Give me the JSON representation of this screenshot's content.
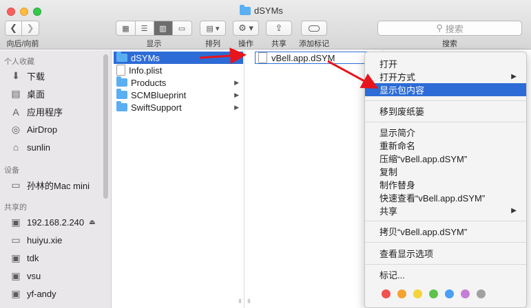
{
  "window": {
    "title": "dSYMs"
  },
  "toolbar": {
    "nav_label": "向后/向前",
    "view_label": "显示",
    "arrange_label": "排列",
    "action_label": "操作",
    "share_label": "共享",
    "tags_label": "添加标记",
    "search_placeholder": "搜索",
    "search_label": "搜索"
  },
  "sidebar": {
    "sections": [
      {
        "title": "个人收藏",
        "items": [
          {
            "label": "下载",
            "icon": "download-icon"
          },
          {
            "label": "桌面",
            "icon": "desktop-icon"
          },
          {
            "label": "应用程序",
            "icon": "applications-icon"
          },
          {
            "label": "AirDrop",
            "icon": "airdrop-icon"
          },
          {
            "label": "sunlin",
            "icon": "home-icon"
          }
        ]
      },
      {
        "title": "设备",
        "items": [
          {
            "label": "孙林的Mac mini",
            "icon": "harddrive-icon"
          }
        ]
      },
      {
        "title": "共享的",
        "items": [
          {
            "label": "192.168.2.240",
            "icon": "server-icon"
          },
          {
            "label": "huiyu.xie",
            "icon": "display-icon"
          },
          {
            "label": "tdk",
            "icon": "display-icon"
          },
          {
            "label": "vsu",
            "icon": "display-icon"
          },
          {
            "label": "yf-andy",
            "icon": "display-icon"
          }
        ]
      }
    ]
  },
  "column1": {
    "items": [
      {
        "name": "dSYMs",
        "type": "folder",
        "selected": true
      },
      {
        "name": "Info.plist",
        "type": "file",
        "selected": false
      },
      {
        "name": "Products",
        "type": "folder",
        "selected": false
      },
      {
        "name": "SCMBlueprint",
        "type": "folder",
        "selected": false
      },
      {
        "name": "SwiftSupport",
        "type": "folder",
        "selected": false
      }
    ]
  },
  "column2": {
    "items": [
      {
        "name": "vBell.app.dSYM",
        "type": "file",
        "selected": true
      }
    ]
  },
  "context_menu": {
    "items": [
      {
        "label": "打开"
      },
      {
        "label": "打开方式",
        "submenu": true
      },
      {
        "label": "显示包内容",
        "highlighted": true
      },
      {
        "separator": true
      },
      {
        "label": "移到废纸篓"
      },
      {
        "separator": true
      },
      {
        "label": "显示简介"
      },
      {
        "label": "重新命名"
      },
      {
        "label": "压缩“vBell.app.dSYM”"
      },
      {
        "label": "复制"
      },
      {
        "label": "制作替身"
      },
      {
        "label": "快速查看“vBell.app.dSYM”"
      },
      {
        "label": "共享",
        "submenu": true
      },
      {
        "separator": true
      },
      {
        "label": "拷贝“vBell.app.dSYM”"
      },
      {
        "separator": true
      },
      {
        "label": "查看显示选项"
      },
      {
        "separator": true
      },
      {
        "label": "标记..."
      }
    ],
    "tag_colors": [
      "#f0524f",
      "#f4a232",
      "#f5d33a",
      "#5ec34c",
      "#4a9ff5",
      "#c47fd6",
      "#a1a1a1"
    ]
  },
  "colors": {
    "selection": "#2d6cd6",
    "annotation_arrow": "#e8141b"
  }
}
